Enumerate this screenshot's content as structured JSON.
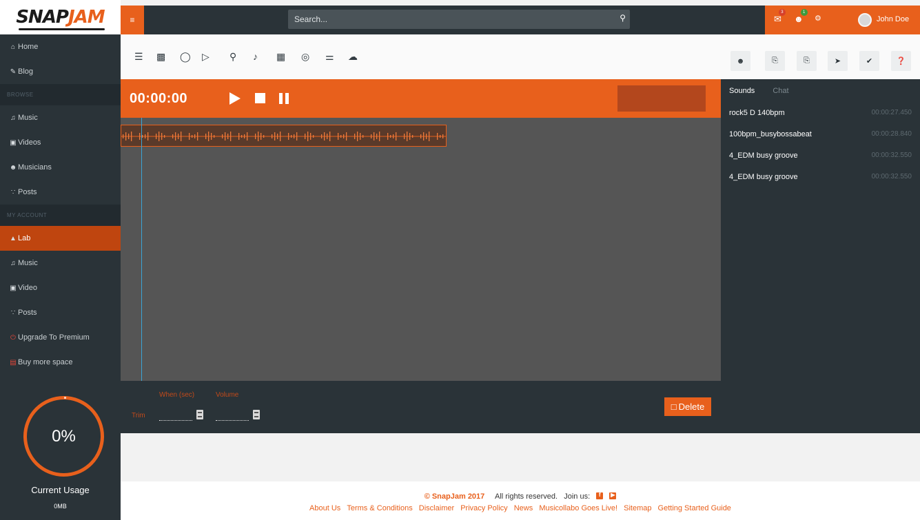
{
  "app": {
    "logo_main": "SNAP",
    "logo_accent": "JAM"
  },
  "topbar": {
    "search_placeholder": "Search...",
    "user_name": "John Doe",
    "notifications": [
      {
        "icon": "envelope-icon",
        "count": "3"
      },
      {
        "icon": "users-icon",
        "count": "1"
      },
      {
        "icon": "cogs-icon",
        "count": ""
      }
    ]
  },
  "sidebar": {
    "items_top": [
      {
        "icon": "home-icon",
        "label": "Home"
      },
      {
        "icon": "pencil-icon",
        "label": "Blog"
      }
    ],
    "section_browse": "BROWSE",
    "items_browse": [
      {
        "icon": "music-icon",
        "label": "Music"
      },
      {
        "icon": "video-icon",
        "label": "Videos"
      },
      {
        "icon": "users-icon",
        "label": "Musicians"
      },
      {
        "icon": "rss-icon",
        "label": "Posts"
      }
    ],
    "section_account": "MY ACCOUNT",
    "items_account": [
      {
        "icon": "flask-icon",
        "label": "Lab",
        "active": true
      },
      {
        "icon": "music-icon",
        "label": "Music"
      },
      {
        "icon": "video-icon",
        "label": "Video"
      },
      {
        "icon": "rss-icon",
        "label": "Posts"
      },
      {
        "icon": "power-icon",
        "label": "Upgrade To Premium"
      },
      {
        "icon": "hdd-icon",
        "label": "Buy more space"
      }
    ],
    "usage": {
      "percent": "0%",
      "label": "Current Usage",
      "value": "0MB"
    }
  },
  "toolbar": {
    "instruments": [
      "mixer-icon",
      "drum-icon",
      "turntable-icon",
      "sampler-icon",
      "microphone-icon",
      "guitar-icon",
      "keyboard-icon",
      "speaker-icon",
      "waveform-icon",
      "soundcloud-icon"
    ],
    "actions": [
      "users-icon",
      "file-export-icon",
      "file-import-icon",
      "share-icon",
      "check-icon",
      "help-icon"
    ]
  },
  "transport": {
    "timecode": "00:00:00"
  },
  "controls": {
    "when_label": "When (sec)",
    "volume_label": "Volume",
    "trim_label": "Trim",
    "delete_label": "Delete"
  },
  "right_panel": {
    "tabs": [
      "Sounds",
      "Chat"
    ],
    "sounds": [
      {
        "name": "rock5 D 140bpm",
        "duration": "00:00:27.450"
      },
      {
        "name": "100bpm_busybossabeat",
        "duration": "00:00:28.840"
      },
      {
        "name": "4_EDM busy groove",
        "duration": "00:00:32.550"
      },
      {
        "name": "4_EDM busy groove",
        "duration": "00:00:32.550"
      }
    ]
  },
  "footer": {
    "copyright": "© SnapJam 2017",
    "rights": "All rights reserved.",
    "join": "Join us:",
    "links": [
      "About Us",
      "Terms & Conditions",
      "Disclaimer",
      "Privacy Policy",
      "News",
      "Musicollabo Goes Live!",
      "Sitemap",
      "Getting Started Guide"
    ]
  },
  "colors": {
    "accent": "#e8601c",
    "dark": "#2a3338",
    "timeline": "#555555",
    "playhead": "#3ba5d7"
  }
}
